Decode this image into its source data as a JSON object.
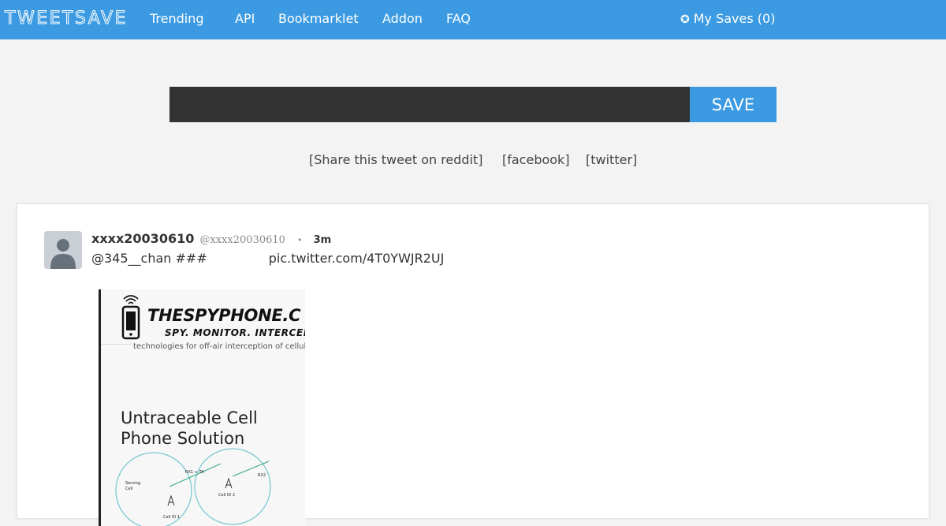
{
  "nav": {
    "logo": "TWEETSAVE",
    "links": [
      "Trending",
      "API",
      "Bookmarklet",
      "Addon",
      "FAQ"
    ],
    "saves_label": "My Saves (0)",
    "saves_icon": "star-icon"
  },
  "form": {
    "input_value": "",
    "save_label": "SAVE"
  },
  "share": {
    "reddit": "[Share this tweet on reddit]",
    "facebook": "[facebook]",
    "twitter": "[twitter]"
  },
  "tweet": {
    "display_name": "xxxx20030610",
    "screen_name": "@xxxx20030610",
    "separator": "•",
    "timestamp": "3m",
    "text": "@345__chan ###",
    "link": "pic.twitter.com/4T0YWJR2UJ",
    "media": {
      "brand": "THESPYPHONE.C",
      "tagline": "SPY. MONITOR. INTERCEP",
      "description": "technologies for off-air interception of cellul",
      "headline_line1": "Untraceable Cell",
      "headline_line2": "Phone Solution",
      "diagram_labels": [
        "RX1 + TA",
        "RX2",
        "Serving",
        "Cell",
        "Cell ID 1",
        "Cell ID 2"
      ]
    }
  },
  "colors": {
    "primary": "#3b9ae1",
    "input_bg": "#333333",
    "page_bg": "#f3f3f3"
  }
}
